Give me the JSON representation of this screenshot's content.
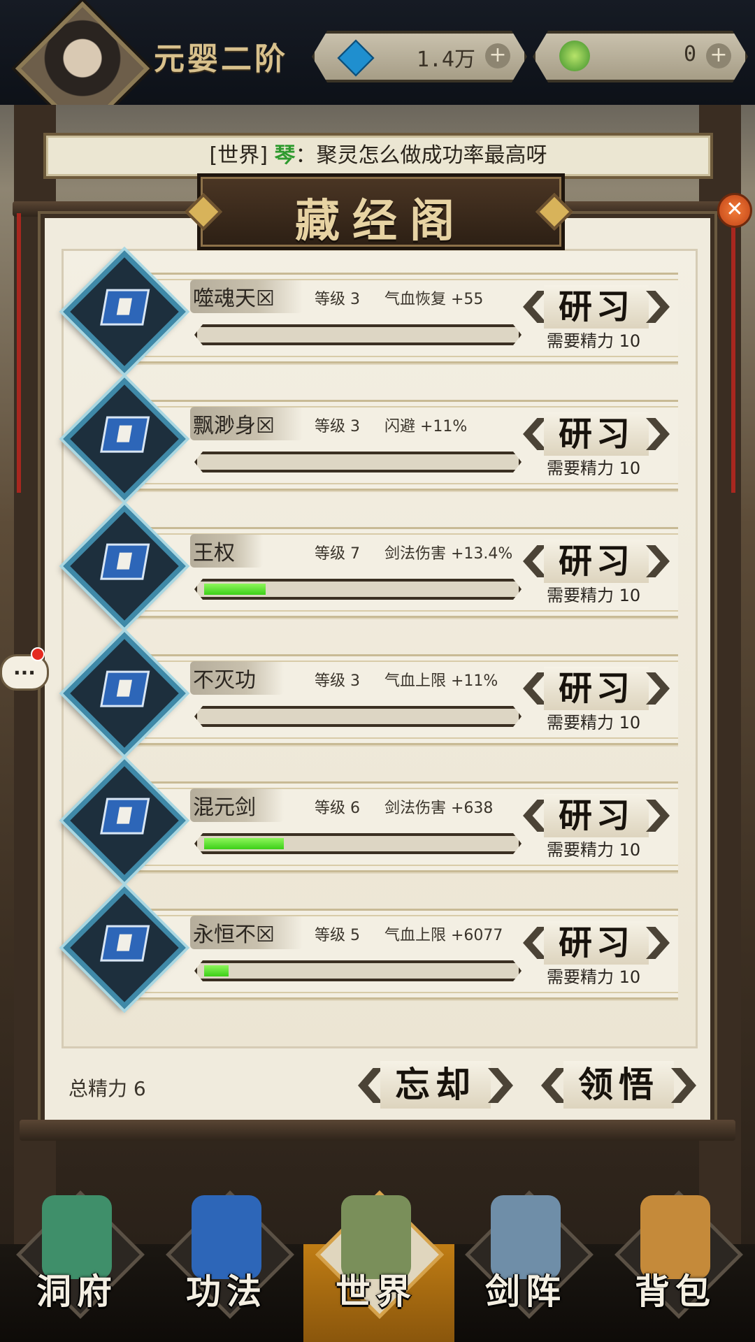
{
  "header": {
    "rank_title": "元婴二阶",
    "resources": [
      {
        "icon": "spirit-gem-icon",
        "value": "1.4万"
      },
      {
        "icon": "jade-coin-icon",
        "value": "0"
      }
    ],
    "plus": "+"
  },
  "chat": {
    "channel": "[世界]",
    "speaker": "琴",
    "separator": "：",
    "message": "聚灵怎么做成功率最高呀"
  },
  "panel": {
    "title": "藏经阁",
    "close_icon": "close-icon",
    "skills": [
      {
        "name": "噬魂天☒",
        "level": "等级 3",
        "effect": "气血恢复 +55",
        "progress": 0.0,
        "button": "研习",
        "cost": "需要精力 10"
      },
      {
        "name": "飘渺身☒",
        "level": "等级 3",
        "effect": "闪避 +11%",
        "progress": 0.0,
        "button": "研习",
        "cost": "需要精力 10"
      },
      {
        "name": "王权",
        "level": "等级 7",
        "effect": "剑法伤害 +13.4%",
        "progress": 0.2,
        "button": "研习",
        "cost": "需要精力 10"
      },
      {
        "name": "不灭功",
        "level": "等级 3",
        "effect": "气血上限 +11%",
        "progress": 0.0,
        "button": "研习",
        "cost": "需要精力 10"
      },
      {
        "name": "混元剑",
        "level": "等级 6",
        "effect": "剑法伤害 +638",
        "progress": 0.26,
        "button": "研习",
        "cost": "需要精力 10"
      },
      {
        "name": "永恒不☒",
        "level": "等级 5",
        "effect": "气血上限 +6077",
        "progress": 0.08,
        "button": "研习",
        "cost": "需要精力 10"
      }
    ],
    "total_energy": "总精力 6",
    "forget_label": "忘却",
    "comprehend_label": "领悟"
  },
  "side": {
    "chat_bubble": "..."
  },
  "nav": {
    "items": [
      {
        "label": "洞府",
        "icon": "cave-dwelling-icon"
      },
      {
        "label": "功法",
        "icon": "technique-book-icon"
      },
      {
        "label": "世界",
        "icon": "world-map-icon",
        "active": true
      },
      {
        "label": "剑阵",
        "icon": "sword-array-icon"
      },
      {
        "label": "背包",
        "icon": "bag-icon"
      }
    ]
  },
  "colors": {
    "progress_fill": "#3ccf18",
    "speaker_green": "#2e9a2e",
    "active_nav": "#c07d14"
  }
}
